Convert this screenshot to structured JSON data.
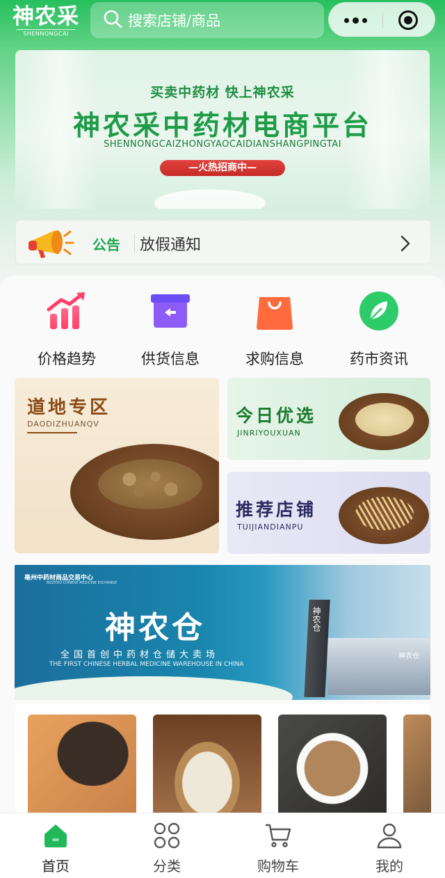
{
  "header": {
    "logo_text": "神农采",
    "logo_sub": "SHENNONGCAI",
    "search_placeholder": "搜索店铺/商品"
  },
  "banner": {
    "slogan": "买卖中药材  快上神农采",
    "title": "神农采中药材电商平台",
    "pinyin": "SHENNONGCAIZHONGYAOCAIDIANSHANGPINGTAI",
    "tag": "—火热招商中—"
  },
  "notice": {
    "label": "公告",
    "text": "放假通知"
  },
  "menu": [
    {
      "label": "价格趋势",
      "icon": "trend-chart-icon"
    },
    {
      "label": "供货信息",
      "icon": "supply-box-icon"
    },
    {
      "label": "求购信息",
      "icon": "shopping-bag-icon"
    },
    {
      "label": "药市资讯",
      "icon": "leaf-news-icon"
    }
  ],
  "cards": {
    "daodi": {
      "title": "道地专区",
      "sub": "DAODIZHUANQV"
    },
    "jinri": {
      "title": "今日优选",
      "sub": "JINRIYOUXUAN"
    },
    "tuijian": {
      "title": "推荐店铺",
      "sub": "TUIJIANDIANPU"
    }
  },
  "warehouse": {
    "org": "亳州中药材商品交易中心",
    "org_en": "BOZHOU CHINESE MEDICINE EXCHANGE",
    "title": "神农仓",
    "sub": "全国首创中药材仓储大卖场",
    "en": "THE FIRST CHINESE HERBAL MEDICINE WAREHOUSE IN CHINA",
    "tower_text": "神农仓",
    "building_text": "神农仓"
  },
  "tabbar": [
    {
      "label": "首页",
      "icon": "home-icon",
      "active": true
    },
    {
      "label": "分类",
      "icon": "category-grid-icon",
      "active": false
    },
    {
      "label": "购物车",
      "icon": "cart-icon",
      "active": false
    },
    {
      "label": "我的",
      "icon": "user-icon",
      "active": false
    }
  ],
  "colors": {
    "brand_green": "#1ea54f",
    "header_green": "#27bf5d",
    "tag_red": "#d5342f"
  }
}
